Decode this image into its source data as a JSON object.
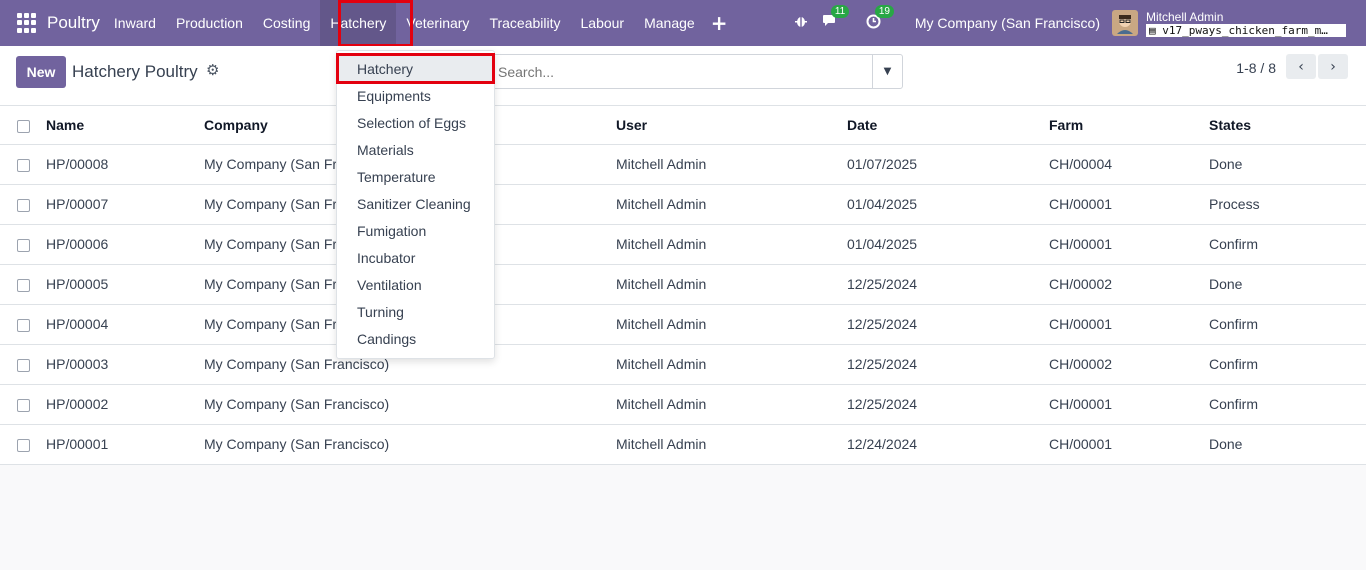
{
  "navbar": {
    "brand": "Poultry",
    "menu": [
      "Inward",
      "Production",
      "Costing",
      "Hatchery",
      "Veterinary",
      "Traceability",
      "Labour",
      "Manage"
    ],
    "plus": "+",
    "messages_badge": "11",
    "activity_badge": "19",
    "company": "My Company (San Francisco)",
    "user_name": "Mitchell Admin",
    "db_name": "v17_pways_chicken_farm_m…"
  },
  "control": {
    "new_label": "New",
    "breadcrumb": "Hatchery Poultry",
    "search_placeholder": "Search...",
    "pager": "1-8 / 8"
  },
  "dropdown": {
    "items": [
      "Hatchery",
      "Equipments",
      "Selection of Eggs",
      "Materials",
      "Temperature",
      "Sanitizer Cleaning",
      "Fumigation",
      "Incubator",
      "Ventilation",
      "Turning",
      "Candings"
    ]
  },
  "table": {
    "headers": [
      "Name",
      "Company",
      "User",
      "Date",
      "Farm",
      "States"
    ],
    "rows": [
      [
        "HP/00008",
        "My Company (San Francisco)",
        "Mitchell Admin",
        "01/07/2025",
        "CH/00004",
        "Done"
      ],
      [
        "HP/00007",
        "My Company (San Francisco)",
        "Mitchell Admin",
        "01/04/2025",
        "CH/00001",
        "Process"
      ],
      [
        "HP/00006",
        "My Company (San Francisco)",
        "Mitchell Admin",
        "01/04/2025",
        "CH/00001",
        "Confirm"
      ],
      [
        "HP/00005",
        "My Company (San Francisco)",
        "Mitchell Admin",
        "12/25/2024",
        "CH/00002",
        "Done"
      ],
      [
        "HP/00004",
        "My Company (San Francisco)",
        "Mitchell Admin",
        "12/25/2024",
        "CH/00001",
        "Confirm"
      ],
      [
        "HP/00003",
        "My Company (San Francisco)",
        "Mitchell Admin",
        "12/25/2024",
        "CH/00002",
        "Confirm"
      ],
      [
        "HP/00002",
        "My Company (San Francisco)",
        "Mitchell Admin",
        "12/25/2024",
        "CH/00001",
        "Confirm"
      ],
      [
        "HP/00001",
        "My Company (San Francisco)",
        "Mitchell Admin",
        "12/24/2024",
        "CH/00001",
        "Done"
      ]
    ]
  },
  "colors": {
    "brand": "#71639e",
    "highlight": "#e3000f",
    "badge": "#28a745"
  }
}
